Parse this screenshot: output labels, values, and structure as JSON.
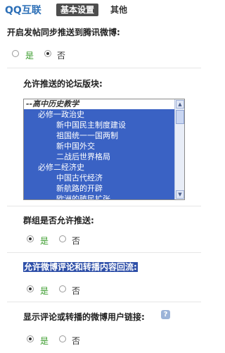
{
  "header": {
    "brand": "QQ互联",
    "tab_basic": "基本设置",
    "tab_other": "其他"
  },
  "q1": {
    "label": "开启发帖同步推送到腾讯微博:",
    "yes": "是",
    "no": "否",
    "selected": "no"
  },
  "q2": {
    "label": "允许推送的论坛版块:",
    "list_header": "--高中历史教学",
    "items": [
      "必修一政治史",
      "新中国民主制度建设",
      "祖国统一一国两制",
      "新中国外交",
      "二战后世界格局",
      "必修二经济史",
      "中国古代经济",
      "新航路的开辟",
      "欧洲的殖民扩张"
    ]
  },
  "q3": {
    "label": "群组是否允许推送:",
    "yes": "是",
    "no": "否",
    "selected": "yes"
  },
  "q4": {
    "label": "允许微博评论和转播内容回流:",
    "yes": "是",
    "no": "否",
    "selected": "yes"
  },
  "q5": {
    "label": "显示评论或转播的微博用户链接:",
    "help": "?",
    "yes": "是",
    "no": "否",
    "selected": "yes"
  }
}
